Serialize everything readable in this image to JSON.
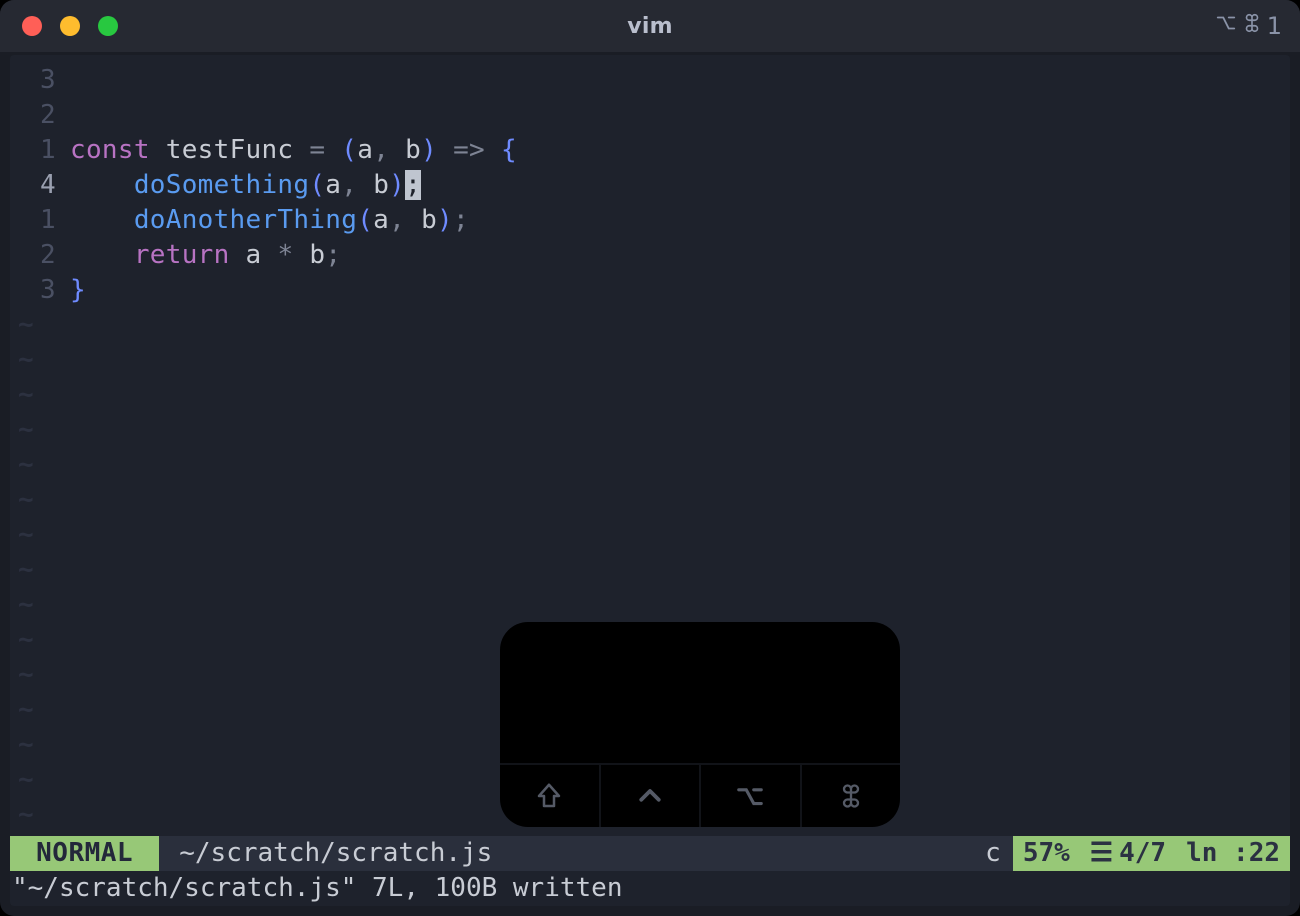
{
  "window": {
    "title": "vim",
    "shortcut_indicator": "⌥⌘1"
  },
  "editor": {
    "cursor_line_index": 3,
    "lines": [
      {
        "relnum": "3",
        "tokens": []
      },
      {
        "relnum": "2",
        "tokens": []
      },
      {
        "relnum": "1",
        "tokens": [
          {
            "t": "const",
            "c": "kw"
          },
          {
            "t": " ",
            "c": ""
          },
          {
            "t": "testFunc",
            "c": "arg"
          },
          {
            "t": " ",
            "c": ""
          },
          {
            "t": "=",
            "c": "op"
          },
          {
            "t": " ",
            "c": ""
          },
          {
            "t": "(",
            "c": "par"
          },
          {
            "t": "a",
            "c": "arg"
          },
          {
            "t": ",",
            "c": "punct"
          },
          {
            "t": " ",
            "c": ""
          },
          {
            "t": "b",
            "c": "arg"
          },
          {
            "t": ")",
            "c": "par"
          },
          {
            "t": " ",
            "c": ""
          },
          {
            "t": "=>",
            "c": "op"
          },
          {
            "t": " ",
            "c": ""
          },
          {
            "t": "{",
            "c": "brace"
          }
        ]
      },
      {
        "relnum": "4",
        "tokens": [
          {
            "t": "    ",
            "c": ""
          },
          {
            "t": "doSomething",
            "c": "fn"
          },
          {
            "t": "(",
            "c": "par"
          },
          {
            "t": "a",
            "c": "arg"
          },
          {
            "t": ",",
            "c": "punct"
          },
          {
            "t": " ",
            "c": ""
          },
          {
            "t": "b",
            "c": "arg"
          },
          {
            "t": ")",
            "c": "par"
          },
          {
            "t": ";",
            "c": "cursor"
          }
        ]
      },
      {
        "relnum": "1",
        "tokens": [
          {
            "t": "    ",
            "c": ""
          },
          {
            "t": "doAnotherThing",
            "c": "fn"
          },
          {
            "t": "(",
            "c": "par"
          },
          {
            "t": "a",
            "c": "arg"
          },
          {
            "t": ",",
            "c": "punct"
          },
          {
            "t": " ",
            "c": ""
          },
          {
            "t": "b",
            "c": "arg"
          },
          {
            "t": ")",
            "c": "par"
          },
          {
            "t": ";",
            "c": "punct"
          }
        ]
      },
      {
        "relnum": "2",
        "tokens": [
          {
            "t": "    ",
            "c": ""
          },
          {
            "t": "return",
            "c": "kw"
          },
          {
            "t": " ",
            "c": ""
          },
          {
            "t": "a",
            "c": "arg"
          },
          {
            "t": " ",
            "c": ""
          },
          {
            "t": "*",
            "c": "op"
          },
          {
            "t": " ",
            "c": ""
          },
          {
            "t": "b",
            "c": "arg"
          },
          {
            "t": ";",
            "c": "punct"
          }
        ]
      },
      {
        "relnum": "3",
        "tokens": [
          {
            "t": "}",
            "c": "brace"
          }
        ]
      }
    ],
    "tilde_count": 15
  },
  "statusline": {
    "mode": "NORMAL",
    "path": "~/scratch/scratch.js",
    "pending_op": "c",
    "percent": "57%",
    "line_ratio": "4/7",
    "col_label": "ln :22"
  },
  "message": "\"~/scratch/scratch.js\" 7L, 100B written",
  "overlay": {
    "modifiers": [
      "shift",
      "control",
      "option",
      "command"
    ]
  }
}
